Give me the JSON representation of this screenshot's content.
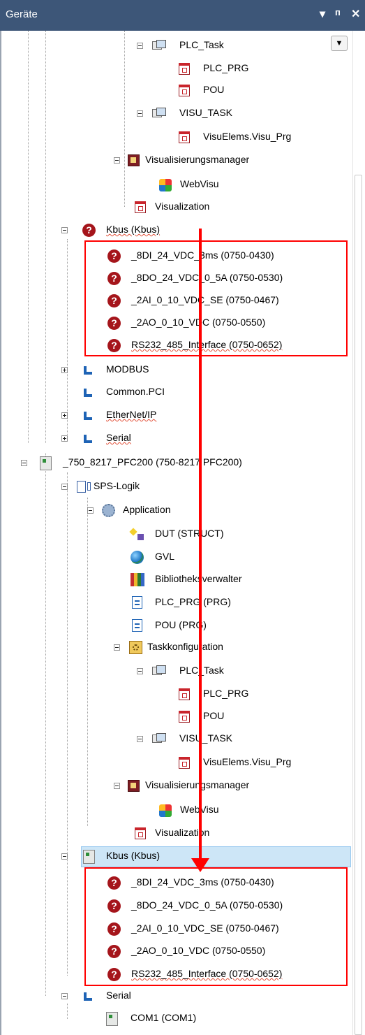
{
  "panel": {
    "title": "Geräte",
    "pin_glyph": "▾",
    "autohide_glyph": "ᴨ",
    "close_glyph": "✕",
    "dropdown_glyph": "▼"
  },
  "tree": {
    "plc_task_1": "PLC_Task",
    "plc_prg_1": "PLC_PRG",
    "pou_1": "POU",
    "visu_task_1": "VISU_TASK",
    "visu_prg_1": "VisuElems.Visu_Prg",
    "visu_manager_1": "Visualisierungsmanager",
    "webvisu_1": "WebVisu",
    "visualization_1": "Visualization",
    "kbus_1": "Kbus (Kbus)",
    "kbus_1_modules": [
      "_8DI_24_VDC_3ms (0750-0430)",
      "_8DO_24_VDC_0_5A (0750-0530)",
      "_2AI_0_10_VDC_SE (0750-0467)",
      "_2AO_0_10_VDC (0750-0550)",
      "RS232_485_Interface (0750-0652)"
    ],
    "modbus": "MODBUS",
    "common_pci": "Common.PCI",
    "ethernet_ip": "EtherNet/IP",
    "serial_1": "Serial",
    "pfc200": "_750_8217_PFC200 (750-8217 PFC200)",
    "sps_logik": "SPS-Logik",
    "application": "Application",
    "dut": "DUT (STRUCT)",
    "gvl": "GVL",
    "bibliotheksverwalter": "Bibliotheksverwalter",
    "plc_prg_prg": "PLC_PRG (PRG)",
    "pou_prg": "POU (PRG)",
    "taskkonfiguration": "Taskkonfiguration",
    "plc_task_2": "PLC_Task",
    "plc_prg_2": "PLC_PRG",
    "pou_2": "POU",
    "visu_task_2": "VISU_TASK",
    "visu_prg_2": "VisuElems.Visu_Prg",
    "visu_manager_2": "Visualisierungsmanager",
    "webvisu_2": "WebVisu",
    "visualization_2": "Visualization",
    "kbus_2": "Kbus (Kbus)",
    "kbus_2_modules": [
      "_8DI_24_VDC_3ms (0750-0430)",
      "_8DO_24_VDC_0_5A (0750-0530)",
      "_2AI_0_10_VDC_SE (0750-0467)",
      "_2AO_0_10_VDC (0750-0550)",
      "RS232_485_Interface (0750-0652)"
    ],
    "serial_2": "Serial",
    "com1": "COM1 (COM1)"
  },
  "icons": {
    "error": "question-mark-error-icon",
    "pou": "pou-icon",
    "task": "task-icon",
    "visu_manager": "visualization-manager-icon",
    "webvisu": "webvisu-icon",
    "bus": "fieldbus-icon",
    "device": "device-icon",
    "plc_logic": "plc-logic-icon",
    "application": "application-icon",
    "dut": "dut-icon",
    "gvl": "gvl-icon",
    "library": "library-icon",
    "program": "program-icon",
    "task_config": "task-configuration-icon"
  },
  "annotation": {
    "highlight_color": "#ff0000",
    "selection_color": "#cde6f7"
  }
}
